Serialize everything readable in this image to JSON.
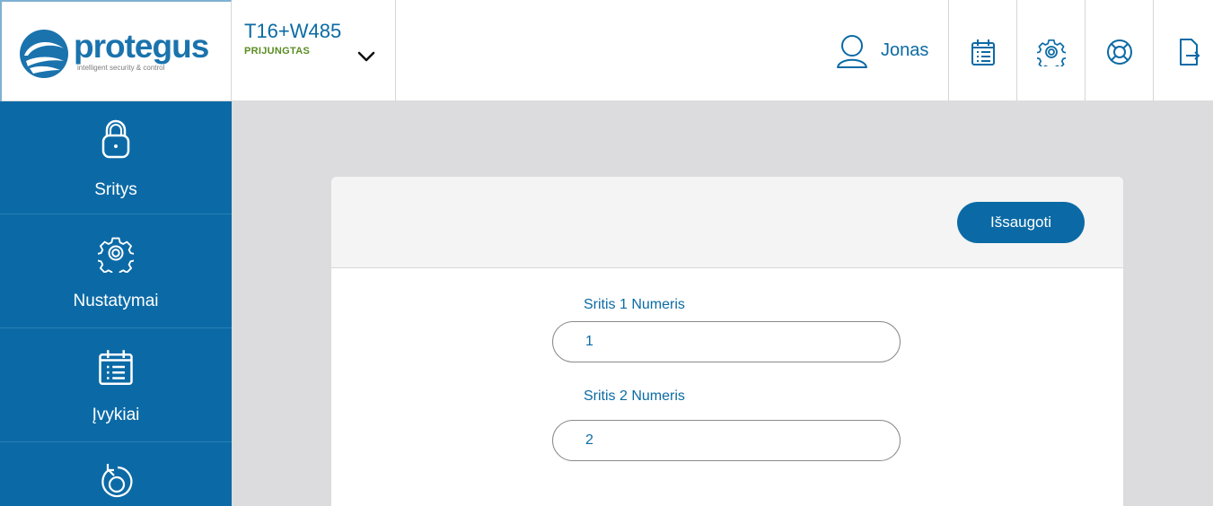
{
  "brand": {
    "name": "protegus",
    "tagline": "intelligent security & control"
  },
  "device": {
    "name": "T16+W485",
    "status": "PRIJUNGTAS"
  },
  "user": {
    "name": "Jonas"
  },
  "toolbar": {
    "icons": [
      "events-calendar-icon",
      "settings-gear-icon",
      "help-lifebuoy-icon",
      "logout-icon"
    ]
  },
  "sidebar": {
    "items": [
      {
        "label": "Sritys",
        "icon": "lock-icon"
      },
      {
        "label": "Nustatymai",
        "icon": "gear-icon"
      },
      {
        "label": "Įvykiai",
        "icon": "calendar-list-icon"
      },
      {
        "label": "",
        "icon": "rotate-icon"
      }
    ]
  },
  "form": {
    "save_label": "Išsaugoti",
    "fields": [
      {
        "label": "Sritis 1 Numeris",
        "value": "1"
      },
      {
        "label": "Sritis 2 Numeris",
        "value": "2"
      }
    ]
  },
  "colors": {
    "primary": "#0b6aa6",
    "status_ok": "#5a8c22",
    "background": "#dcdcde"
  }
}
